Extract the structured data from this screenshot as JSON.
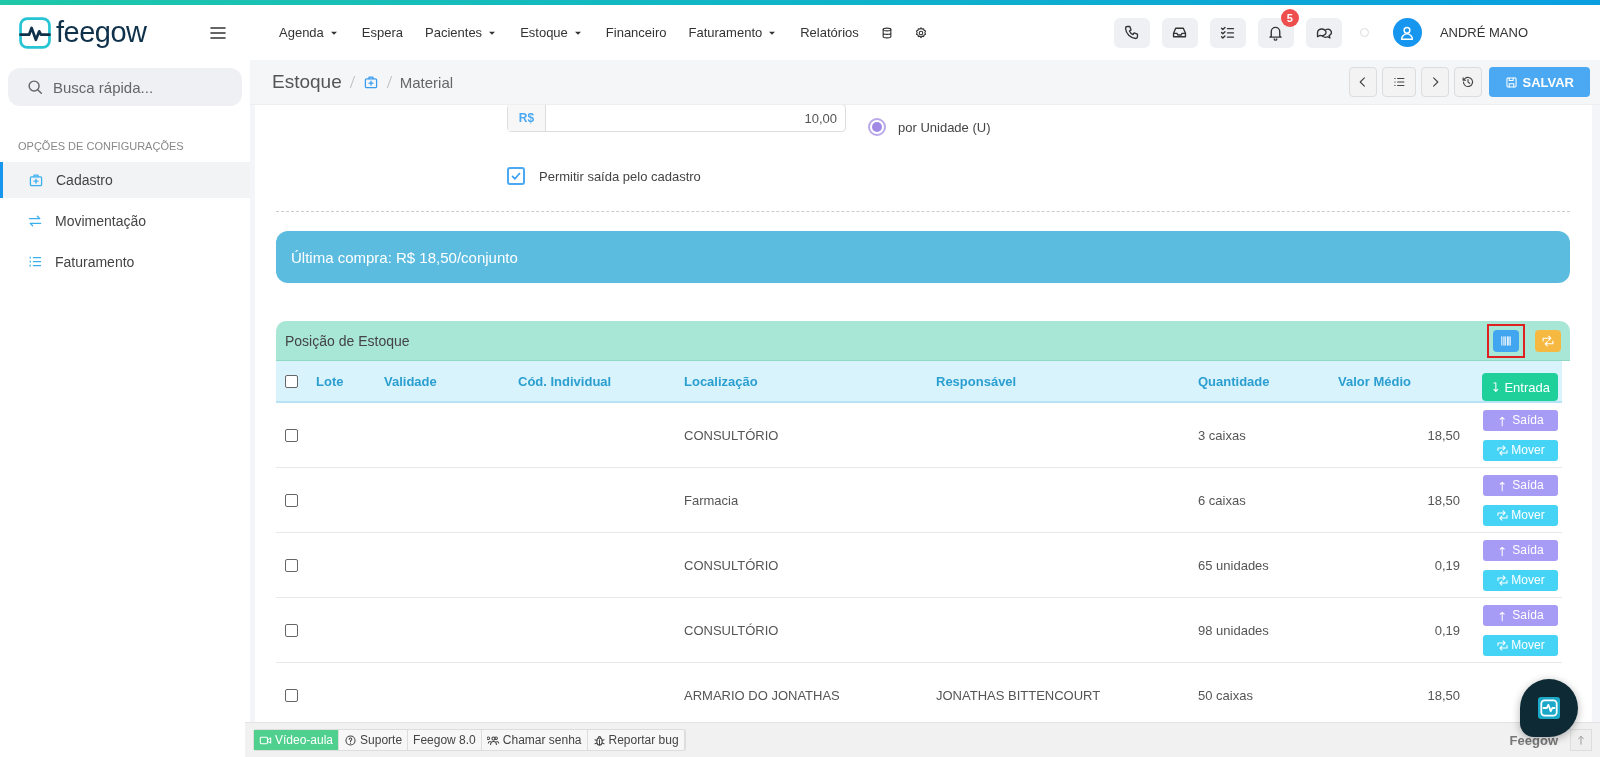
{
  "header": {
    "logo": "feegow",
    "nav": [
      {
        "label": "Agenda",
        "dropdown": true
      },
      {
        "label": "Espera",
        "dropdown": false
      },
      {
        "label": "Pacientes",
        "dropdown": true
      },
      {
        "label": "Estoque",
        "dropdown": true
      },
      {
        "label": "Financeiro",
        "dropdown": false
      },
      {
        "label": "Faturamento",
        "dropdown": true
      },
      {
        "label": "Relatórios",
        "dropdown": false
      }
    ],
    "tools": [
      {
        "kind": "phone"
      },
      {
        "kind": "inbox"
      },
      {
        "kind": "tasks"
      },
      {
        "kind": "bell",
        "badge": "5"
      },
      {
        "kind": "chat"
      }
    ],
    "user": "ANDRÉ MANO"
  },
  "sidebar": {
    "search_placeholder": "Busca rápida...",
    "section": "OPÇÕES DE CONFIGURAÇÕES",
    "items": [
      {
        "label": "Cadastro",
        "kind": "kit",
        "selected": true
      },
      {
        "label": "Movimentação",
        "kind": "swap",
        "selected": false
      },
      {
        "label": "Faturamento",
        "kind": "list",
        "selected": false
      }
    ]
  },
  "breadcrumb": {
    "section": "Estoque",
    "page": "Material"
  },
  "toolbar": {
    "save": "SALVAR"
  },
  "form": {
    "currency": "R$",
    "price": "10,00",
    "radio": {
      "label": "por Unidade (U)",
      "selected": true
    },
    "checkbox": {
      "label": "Permitir saída pelo cadastro",
      "checked": true
    }
  },
  "info": "Última compra: R$ 18,50/conjunto",
  "stock": {
    "title": "Posição de Estoque",
    "header_buttons": [
      {
        "kind": "barcode",
        "highlighted": true
      },
      {
        "kind": "transfer",
        "highlighted": false
      }
    ],
    "all_checked": false,
    "columns": [
      "Lote",
      "Validade",
      "Cód. Individual",
      "Localização",
      "Responsável",
      "Quantidade",
      "Valor Médio"
    ],
    "entry_button": "Entrada",
    "rows": [
      {
        "checked": false,
        "cells": [
          "",
          "",
          "",
          "CONSULTÓRIO",
          "",
          "3 caixas",
          "18,50"
        ],
        "actions": [
          "Saída",
          "Mover"
        ]
      },
      {
        "checked": false,
        "cells": [
          "",
          "",
          "",
          "Farmacia",
          "",
          "6 caixas",
          "18,50"
        ],
        "actions": [
          "Saída",
          "Mover"
        ]
      },
      {
        "checked": false,
        "cells": [
          "",
          "",
          "",
          "CONSULTÓRIO",
          "",
          "65 unidades",
          "0,19"
        ],
        "actions": [
          "Saída",
          "Mover"
        ]
      },
      {
        "checked": false,
        "cells": [
          "",
          "",
          "",
          "CONSULTÓRIO",
          "",
          "98 unidades",
          "0,19"
        ],
        "actions": [
          "Saída",
          "Mover"
        ]
      },
      {
        "checked": false,
        "cells": [
          "",
          "",
          "",
          "ARMARIO DO JONATHAS",
          "JONATHAS BITTENCOURT",
          "50 caixas",
          "18,50"
        ],
        "actions": []
      }
    ]
  },
  "footer": {
    "links": [
      {
        "label": "Vídeo-aula",
        "kind": "video"
      },
      {
        "label": "Suporte",
        "kind": "help"
      },
      {
        "label": "Feegow 8.0",
        "kind": "none"
      },
      {
        "label": "Chamar senha",
        "kind": "people"
      },
      {
        "label": "Reportar bug",
        "kind": "bug"
      }
    ],
    "brand": "Feegow"
  }
}
